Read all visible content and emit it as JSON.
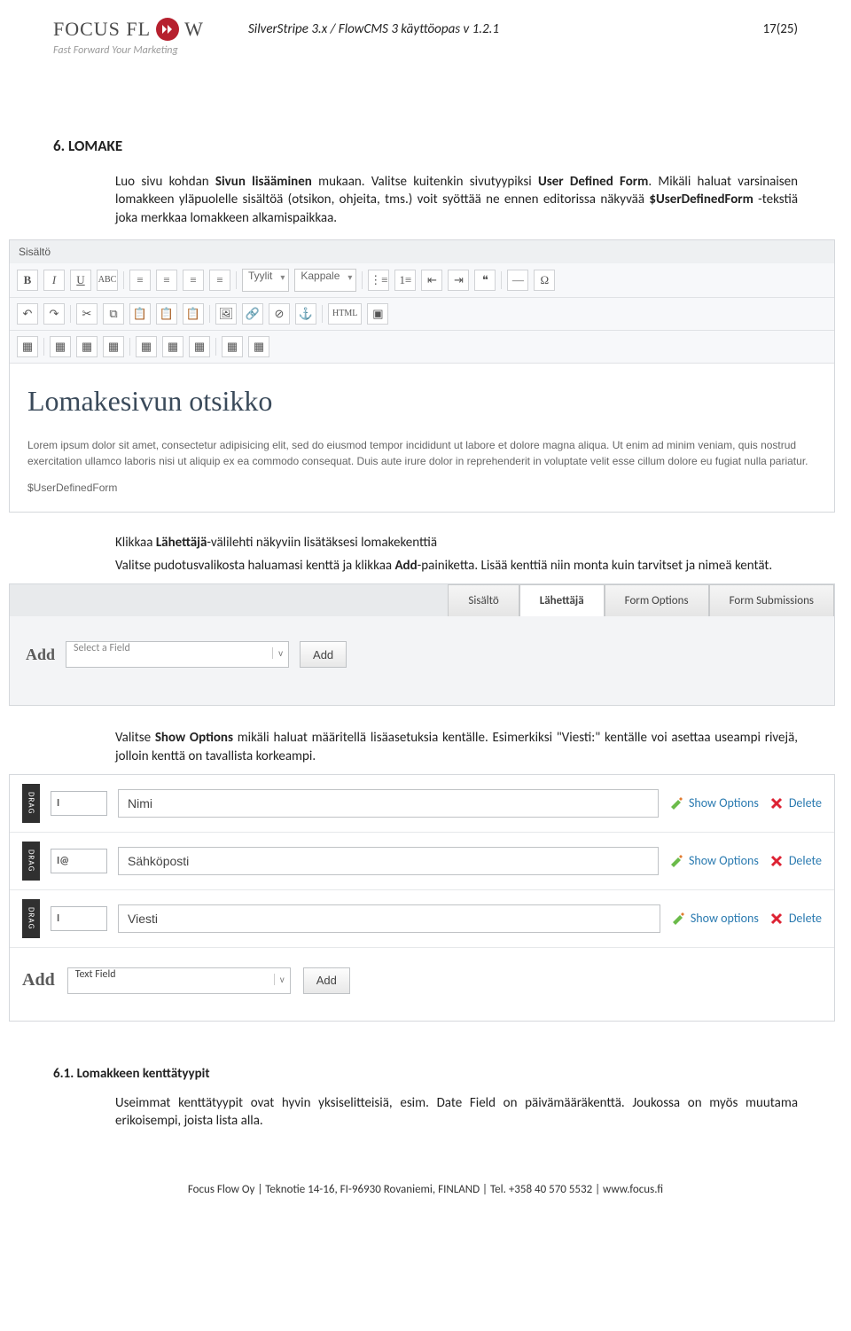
{
  "header": {
    "logo_text": "FOCUS FL",
    "logo_suffix": "W",
    "tagline": "Fast Forward Your Marketing",
    "doc_title": "SilverStripe 3.x / FlowCMS 3 käyttöopas v 1.2.1",
    "page_num": "17(25)"
  },
  "section": {
    "heading": "6.   LOMAKE",
    "p1_a": "Luo sivu kohdan ",
    "p1_b": "Sivun lisääminen",
    "p1_c": " mukaan. Valitse kuitenkin sivutyypiksi ",
    "p1_d": "User Defined Form",
    "p1_e": ". Mikäli haluat varsinaisen lomakkeen yläpuolelle sisältöä (otsikon, ohjeita, tms.) voit syöttää ne ennen editorissa näkyvää ",
    "p1_f": "$UserDefinedForm",
    "p1_g": " -tekstiä joka merkkaa lomakkeen alkamispaikkaa."
  },
  "editor": {
    "tab": "Sisältö",
    "dd_styles": "Tyylit",
    "dd_format": "Kappale",
    "html_btn": "HTML",
    "heading": "Lomakesivun otsikko",
    "lorem": "Lorem ipsum dolor sit amet, consectetur adipisicing elit, sed do eiusmod tempor incididunt ut labore et dolore magna aliqua. Ut enim ad minim veniam, quis nostrud exercitation ullamco laboris nisi ut aliquip ex ea commodo consequat. Duis aute irure dolor in reprehenderit in voluptate velit esse cillum dolore eu fugiat nulla pariatur.",
    "placeholder": "$UserDefinedForm"
  },
  "mid": {
    "p2_a": "Klikkaa ",
    "p2_b": "Lähettäjä",
    "p2_c": "-välilehti näkyviin lisätäksesi lomakekenttiä",
    "p3_a": "Valitse pudotusvalikosta haluamasi kenttä ja klikkaa ",
    "p3_b": "Add",
    "p3_c": "-painiketta. Lisää kenttiä niin monta kuin tarvitset ja nimeä kentät."
  },
  "tabs": {
    "t1": "Sisältö",
    "t2": "Lähettäjä",
    "t3": "Form Options",
    "t4": "Form Submissions",
    "add_label": "Add",
    "select_placeholder": "Select a Field",
    "add_btn": "Add"
  },
  "mid2": {
    "p4_a": "Valitse ",
    "p4_b": "Show Options",
    "p4_c": " mikäli haluat määritellä lisäasetuksia kentälle. Esimerkiksi \"Viesti:\" kentälle voi asettaa useampi rivejä, jolloin kenttä on tavallista korkeampi."
  },
  "fields": {
    "drag": "DRAG",
    "rows": [
      {
        "icon": "I",
        "name": "Nimi",
        "opt": "Show Options",
        "del": "Delete"
      },
      {
        "icon": "I@",
        "name": "Sähköposti",
        "opt": "Show Options",
        "del": "Delete"
      },
      {
        "icon": "I",
        "name": "Viesti",
        "opt": "Show options",
        "del": "Delete"
      }
    ],
    "add_lbl": "Add",
    "add_sel": "Text Field",
    "add_btn": "Add"
  },
  "sub": {
    "heading": "6.1.   Lomakkeen kenttätyypit",
    "para": "Useimmat kenttätyypit ovat hyvin yksiselitteisiä, esim. Date Field on päivämääräkenttä. Joukossa on myös muutama erikoisempi, joista lista alla."
  },
  "footer": "Focus Flow Oy  |  Teknotie 14-16, FI-96930 Rovaniemi, FINLAND  |  Tel. +358 40 570 5532  |  www.focus.fi"
}
